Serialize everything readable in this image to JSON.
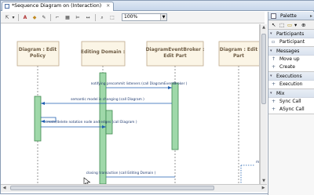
{
  "editor": {
    "tab_title": "*Sequence Diagram on (Interaction)",
    "tab_close": "✕",
    "zoom": "100%",
    "toolbar_icons": [
      "selection-tool-icon",
      "dropdown-arrow-icon",
      "font-color-icon",
      "fill-color-icon",
      "line-color-icon",
      "route-icon",
      "arrange-icon",
      "align-icon",
      "sizing-icon",
      "zoom-icon"
    ]
  },
  "palette": {
    "title": "Palette",
    "drawers": [
      {
        "name": "Participants",
        "items": [
          "Participant"
        ]
      },
      {
        "name": "Messages",
        "items": [
          "Move up",
          "Create"
        ]
      },
      {
        "name": "Executions",
        "items": [
          "Execution"
        ]
      },
      {
        "name": "Mix",
        "items": [
          "Sync Call",
          "ASync Call"
        ]
      }
    ]
  },
  "diagram": {
    "participants": [
      {
        "line1": "Diagram : Edit",
        "line2": "Policy"
      },
      {
        "line1": "Editing Domain :",
        "line2": ""
      },
      {
        "line1": "DiagramEventBroker :",
        "line2": "Edit Part"
      },
      {
        "line1": "Diagram : Edit",
        "line2": "Part"
      }
    ],
    "messages": [
      "notifying precommit listeners (call DiagramEventBroker )",
      "semantic model is changing (call Diagram )",
      "create/delete notation node and edges (call Diagram )",
      "closing transaction (call Editing Domain )"
    ],
    "colors": {
      "participant_fill": "#fbf5e6",
      "participant_border": "#bfa98a",
      "execution_fill": "#9fd8a9",
      "execution_border": "#3f8a4f",
      "message": "#1f5fb0",
      "lifeline": "#7a7a7a"
    }
  }
}
